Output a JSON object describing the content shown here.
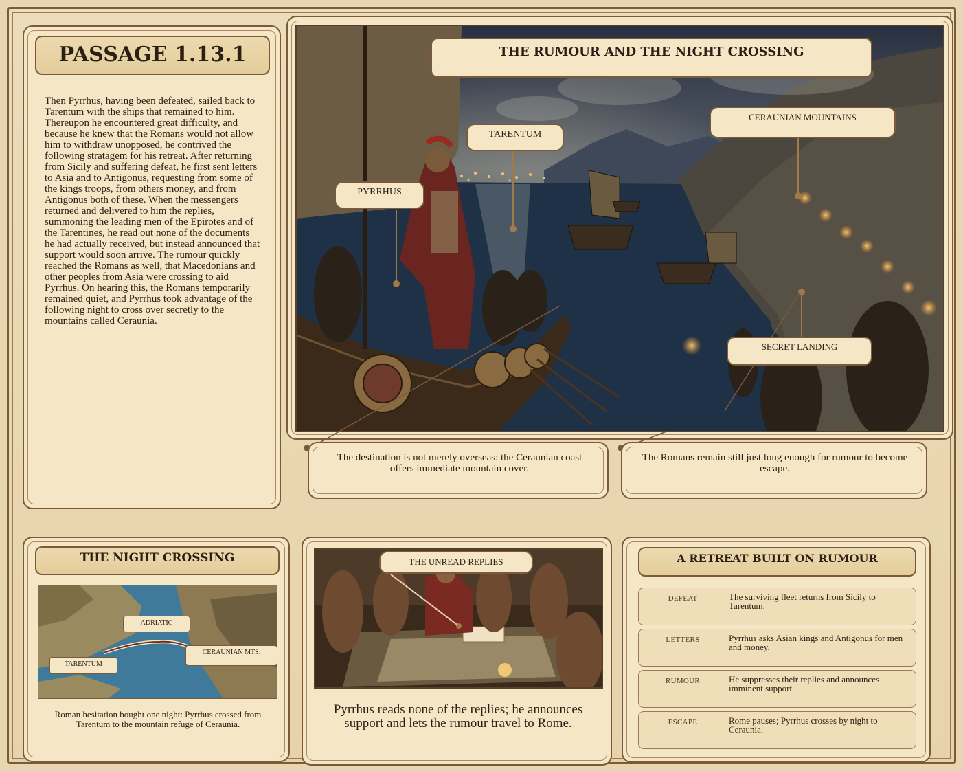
{
  "passage": {
    "title": "PASSAGE 1.13.1",
    "text": "Then Pyrrhus, having been defeated, sailed back to Tarentum with the ships that remained to him. Thereupon he encountered great difficulty, and because he knew that the Romans would not allow him to withdraw unopposed, he contrived the following stratagem for his retreat. After returning from Sicily and suffering defeat, he first sent letters to Asia and to Antigonus, requesting from some of the kings troops, from others money, and from Antigonus both of these. When the messengers returned and delivered to him the replies, summoning the leading men of the Epirotes and of the Tarentines, he read out none of the documents he had actually received, but instead announced that support would soon arrive. The rumour quickly reached the Romans as well, that Macedonians and other peoples from Asia were crossing to aid Pyrrhus. On hearing this, the Romans temporarily remained quiet, and Pyrrhus took advantage of the following night to cross over secretly to the mountains called Ceraunia."
  },
  "main_scene": {
    "title": "THE RUMOUR AND THE NIGHT CROSSING",
    "labels": {
      "pyrrhus": "PYRRHUS",
      "tarentum": "TARENTUM",
      "ceraunian": "CERAUNIAN MOUNTAINS",
      "landing": "SECRET LANDING"
    },
    "notes": [
      "The destination is not merely overseas: the Ceraunian coast offers immediate mountain cover.",
      "The Romans remain still just long enough for rumour to become escape."
    ]
  },
  "night_crossing": {
    "title": "THE NIGHT CROSSING",
    "map_labels": {
      "adriatic": "ADRIATIC",
      "tarentum": "TARENTUM",
      "ceraunia": "CERAUNIAN MTS."
    },
    "caption": "Roman hesitation bought one night: Pyrrhus crossed from Tarentum to the mountain refuge of Ceraunia."
  },
  "unread_replies": {
    "label": "THE UNREAD REPLIES",
    "caption": "Pyrrhus reads none of the replies; he announces support and lets the rumour travel to Rome."
  },
  "retreat": {
    "title": "A RETREAT BUILT ON RUMOUR",
    "rows": [
      {
        "key": "DEFEAT",
        "value": "The surviving fleet returns from Sicily to Tarentum."
      },
      {
        "key": "LETTERS",
        "value": "Pyrrhus asks Asian kings and Antigonus for men and money."
      },
      {
        "key": "RUMOUR",
        "value": "He suppresses their replies and announces imminent support."
      },
      {
        "key": "ESCAPE",
        "value": "Rome pauses; Pyrrhus crosses by night to Ceraunia."
      }
    ]
  },
  "colors": {
    "parchment": "#f5e6c6",
    "border": "#7a5a3a",
    "sea_night": "#1e2c3e",
    "torch": "#f0a640"
  }
}
